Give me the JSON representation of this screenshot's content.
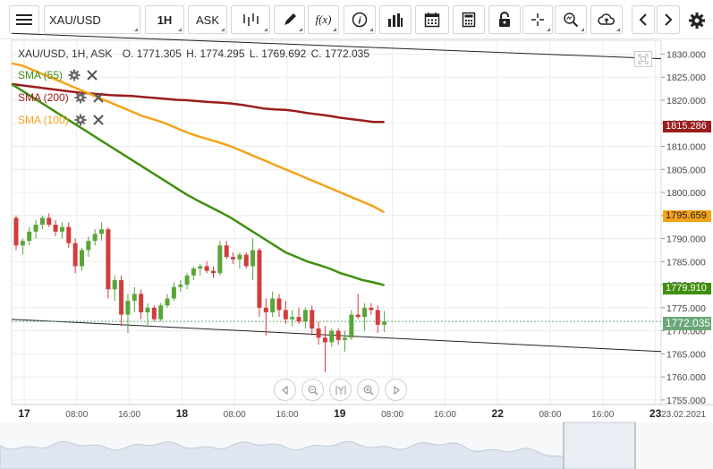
{
  "toolbar": {
    "symbol": "XAU/USD",
    "interval": "1H",
    "price_type": "ASK",
    "icons": [
      "menu-icon",
      "bar-type-icon",
      "draw-pencil-icon",
      "function-icon",
      "info-icon",
      "volume-bars-icon",
      "calendar-icon",
      "calculator-icon",
      "lock-icon",
      "crosshair-icon",
      "zoom-icon",
      "cloud-upload-icon",
      "arrow-left-icon",
      "arrow-right-icon",
      "gear-icon"
    ],
    "function_label": "f(x)"
  },
  "header": {
    "instrument": "XAU/USD, 1H, ASK",
    "open": "O. 1771.305",
    "high": "H. 1774.295",
    "low": "L. 1769.692",
    "close": "C. 1772.035"
  },
  "indicators": [
    {
      "label": "SMA (55)",
      "color": "#3f8f0f"
    },
    {
      "label": "SMA (200)",
      "color": "#9b1c1c"
    },
    {
      "label": "SMA (100)",
      "color": "#f5a31a"
    }
  ],
  "price_tags": {
    "sma200": "1815.286",
    "sma100": "1795.659",
    "sma55": "1779.910",
    "last": "1772.035"
  },
  "chart_data": {
    "type": "candlestick",
    "symbol": "XAU/USD",
    "ylim": [
      1754,
      1833
    ],
    "y_ticks": [
      "1830.000",
      "1825.000",
      "1820.000",
      "1815.000",
      "1810.000",
      "1805.000",
      "1800.000",
      "1795.000",
      "1790.000",
      "1785.000",
      "1780.000",
      "1775.000",
      "1770.000",
      "1765.000",
      "1760.000",
      "1755.000"
    ],
    "x_ticks": [
      {
        "label": "17",
        "bold": true
      },
      {
        "label": "08:00",
        "bold": false
      },
      {
        "label": "16:00",
        "bold": false
      },
      {
        "label": "18",
        "bold": true
      },
      {
        "label": "08:00",
        "bold": false
      },
      {
        "label": "16:00",
        "bold": false
      },
      {
        "label": "19",
        "bold": true
      },
      {
        "label": "08:00",
        "bold": false
      },
      {
        "label": "16:00",
        "bold": false
      },
      {
        "label": "22",
        "bold": true
      },
      {
        "label": "08:00",
        "bold": false
      },
      {
        "label": "16:00",
        "bold": false
      },
      {
        "label": "23",
        "bold": true
      },
      {
        "label": "23.02.2021",
        "bold": false
      }
    ],
    "candles": [
      [
        1794.5,
        1795.0,
        1787.5,
        1788.5
      ],
      [
        1788.5,
        1790.0,
        1786.5,
        1789.5
      ],
      [
        1789.5,
        1792.5,
        1788.5,
        1791.5
      ],
      [
        1791.5,
        1794.0,
        1790.0,
        1793.0
      ],
      [
        1793.0,
        1795.0,
        1792.0,
        1794.5
      ],
      [
        1794.5,
        1795.5,
        1792.5,
        1793.0
      ],
      [
        1793.0,
        1794.0,
        1790.5,
        1791.5
      ],
      [
        1791.5,
        1793.5,
        1790.0,
        1792.5
      ],
      [
        1792.5,
        1793.5,
        1788.0,
        1789.0
      ],
      [
        1789.0,
        1790.0,
        1782.5,
        1784.0
      ],
      [
        1784.0,
        1788.0,
        1783.0,
        1787.5
      ],
      [
        1787.5,
        1790.5,
        1786.0,
        1789.5
      ],
      [
        1789.5,
        1792.0,
        1788.5,
        1791.0
      ],
      [
        1791.0,
        1793.5,
        1789.5,
        1792.0
      ],
      [
        1792.0,
        1792.5,
        1777.0,
        1779.0
      ],
      [
        1779.0,
        1782.0,
        1776.5,
        1781.0
      ],
      [
        1781.0,
        1782.0,
        1771.0,
        1773.5
      ],
      [
        1773.5,
        1778.0,
        1769.5,
        1776.5
      ],
      [
        1776.5,
        1779.5,
        1774.0,
        1778.0
      ],
      [
        1778.0,
        1779.0,
        1772.5,
        1774.0
      ],
      [
        1774.0,
        1776.0,
        1771.0,
        1775.0
      ],
      [
        1775.0,
        1775.5,
        1772.0,
        1772.5
      ],
      [
        1772.5,
        1776.0,
        1772.0,
        1775.5
      ],
      [
        1775.5,
        1778.0,
        1775.0,
        1777.0
      ],
      [
        1777.0,
        1780.5,
        1776.5,
        1779.5
      ],
      [
        1779.5,
        1781.0,
        1778.5,
        1780.0
      ],
      [
        1780.0,
        1782.5,
        1779.0,
        1782.0
      ],
      [
        1782.0,
        1784.0,
        1781.0,
        1783.5
      ],
      [
        1783.5,
        1784.5,
        1782.0,
        1784.0
      ],
      [
        1784.0,
        1785.0,
        1782.5,
        1783.0
      ],
      [
        1783.0,
        1784.0,
        1781.5,
        1782.5
      ],
      [
        1782.5,
        1789.5,
        1782.0,
        1788.5
      ],
      [
        1788.5,
        1789.5,
        1785.5,
        1786.0
      ],
      [
        1786.0,
        1787.0,
        1784.5,
        1785.5
      ],
      [
        1785.5,
        1787.0,
        1783.5,
        1786.5
      ],
      [
        1786.5,
        1787.0,
        1783.5,
        1784.0
      ],
      [
        1784.0,
        1790.0,
        1781.0,
        1787.5
      ],
      [
        1787.5,
        1788.0,
        1773.0,
        1775.0
      ],
      [
        1775.0,
        1777.0,
        1769.0,
        1774.0
      ],
      [
        1774.0,
        1778.5,
        1773.0,
        1777.0
      ],
      [
        1777.0,
        1778.0,
        1773.0,
        1774.5
      ],
      [
        1774.5,
        1776.5,
        1771.5,
        1772.5
      ],
      [
        1772.5,
        1774.5,
        1771.0,
        1773.0
      ],
      [
        1773.0,
        1775.0,
        1771.5,
        1772.0
      ],
      [
        1772.0,
        1775.0,
        1770.5,
        1774.5
      ],
      [
        1774.5,
        1775.5,
        1769.0,
        1770.5
      ],
      [
        1770.5,
        1772.0,
        1767.0,
        1768.5
      ],
      [
        1768.5,
        1771.0,
        1761.0,
        1767.5
      ],
      [
        1767.5,
        1770.5,
        1766.5,
        1770.0
      ],
      [
        1770.0,
        1770.5,
        1767.0,
        1768.0
      ],
      [
        1768.0,
        1770.0,
        1765.5,
        1768.5
      ],
      [
        1768.5,
        1774.5,
        1768.0,
        1773.5
      ],
      [
        1773.5,
        1778.0,
        1772.5,
        1773.0
      ],
      [
        1773.0,
        1776.0,
        1770.0,
        1775.0
      ],
      [
        1775.0,
        1776.0,
        1773.5,
        1774.5
      ],
      [
        1774.5,
        1775.5,
        1769.5,
        1771.3
      ],
      [
        1771.3,
        1774.3,
        1769.7,
        1772.0
      ]
    ],
    "sma55": [
      1823.5,
      1822.0,
      1820.5,
      1819.0,
      1817.5,
      1816.0,
      1814.5,
      1813.0,
      1811.5,
      1810.0,
      1808.5,
      1807.0,
      1805.5,
      1804.0,
      1802.5,
      1801.0,
      1799.5,
      1798.2,
      1797.0,
      1795.8,
      1794.5,
      1793.0,
      1791.5,
      1790.0,
      1788.5,
      1787.0,
      1786.0,
      1785.0,
      1784.3,
      1783.5,
      1782.5,
      1781.8,
      1781.0,
      1780.5,
      1779.9
    ],
    "sma100": [
      1828.0,
      1827.5,
      1826.5,
      1825.5,
      1824.5,
      1823.5,
      1822.5,
      1821.5,
      1820.5,
      1819.5,
      1818.5,
      1817.5,
      1816.5,
      1815.8,
      1815.0,
      1814.0,
      1813.0,
      1812.2,
      1811.5,
      1810.8,
      1810.0,
      1809.0,
      1808.0,
      1807.0,
      1806.0,
      1805.0,
      1804.0,
      1803.0,
      1802.0,
      1801.0,
      1800.0,
      1799.0,
      1798.0,
      1797.0,
      1795.7
    ],
    "sma200": [
      1823.5,
      1823.2,
      1822.9,
      1822.6,
      1822.3,
      1822.0,
      1821.7,
      1821.5,
      1821.3,
      1821.1,
      1821.0,
      1820.9,
      1820.7,
      1820.5,
      1820.3,
      1820.1,
      1820.0,
      1819.8,
      1819.6,
      1819.5,
      1819.3,
      1819.0,
      1818.6,
      1818.2,
      1818.0,
      1817.9,
      1817.6,
      1817.2,
      1816.9,
      1816.6,
      1816.2,
      1815.9,
      1815.6,
      1815.3,
      1815.3
    ],
    "trendline_lower": [
      [
        0,
        1772.5
      ],
      [
        1,
        1765.5
      ]
    ],
    "trendline_upper": [
      [
        0,
        1834.5
      ],
      [
        1,
        1829.0
      ]
    ],
    "last_price": 1772.035,
    "colors": {
      "up": "#5aa53a",
      "down": "#d23c3c",
      "grid": "#ececec",
      "axis_text": "#444"
    }
  },
  "navigator": {
    "buttons": [
      "scroll-left-icon",
      "zoom-out-icon",
      "fit-icon",
      "zoom-in-icon",
      "scroll-right-icon"
    ]
  }
}
